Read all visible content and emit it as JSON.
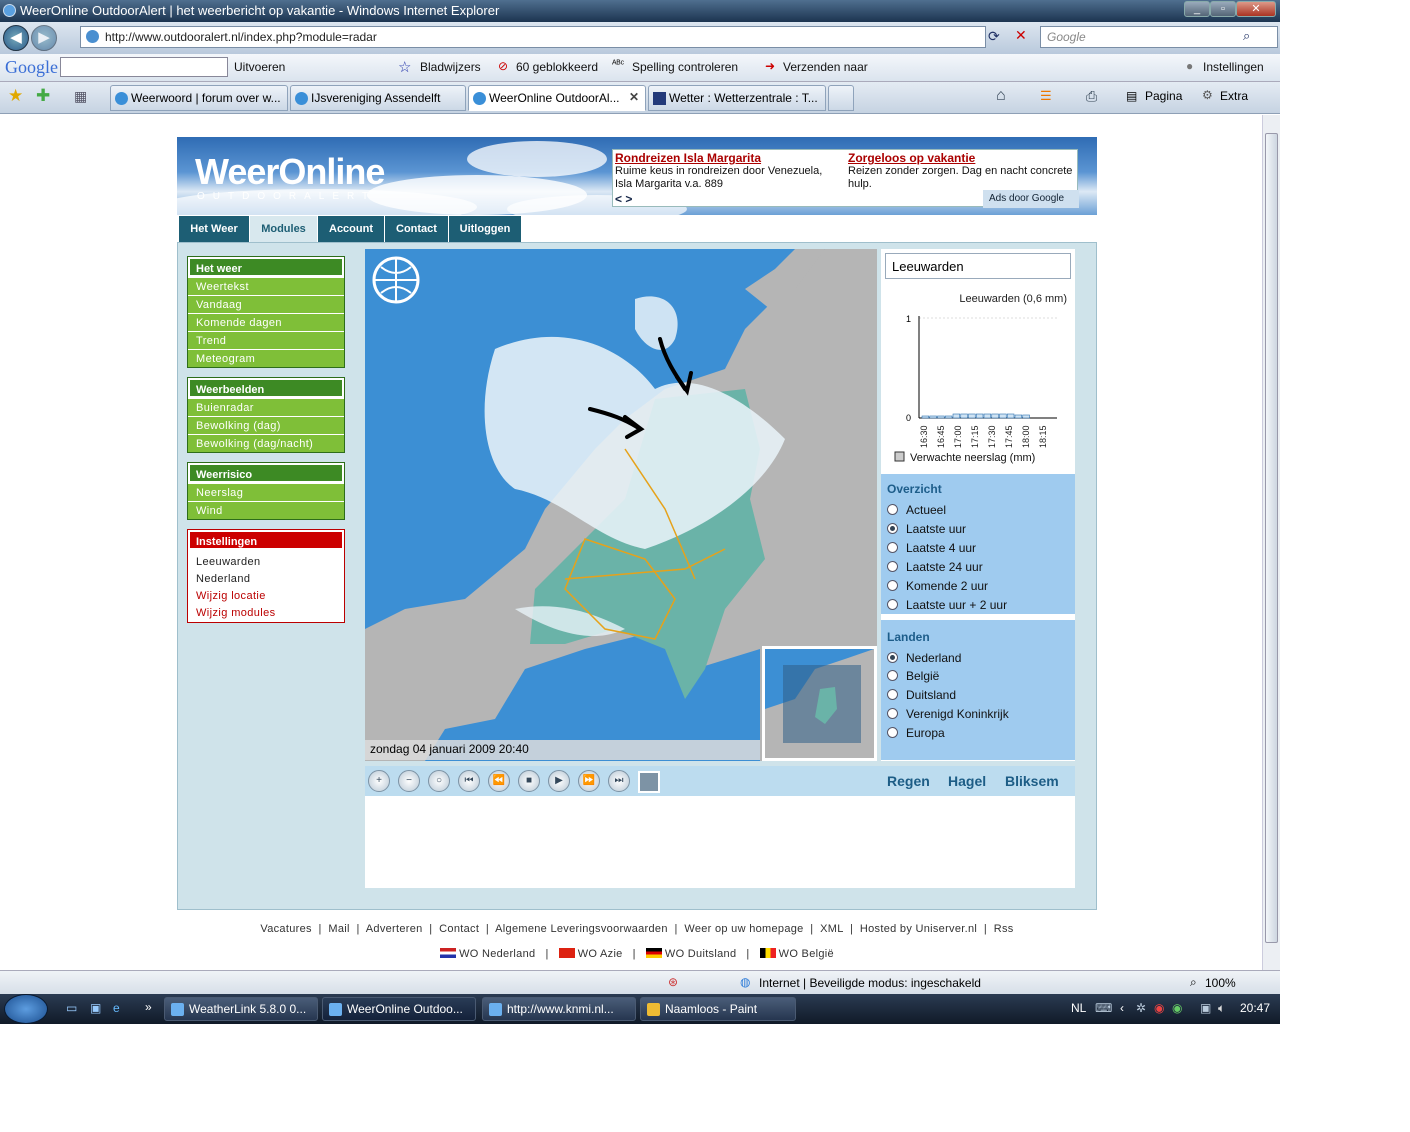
{
  "window": {
    "title": "WeerOnline OutdoorAlert | het weerbericht op vakantie - Windows Internet Explorer"
  },
  "address": {
    "url": "http://www.outdooralert.nl/index.php?module=radar",
    "search_placeholder": "Google"
  },
  "google_toolbar": {
    "logo": "Google",
    "go": "Uitvoeren",
    "bookmarks": "Bladwijzers",
    "blocked": "60 geblokkeerd",
    "spell": "Spelling controleren",
    "send": "Verzenden naar",
    "settings": "Instellingen"
  },
  "tabs": [
    {
      "label": "Weerwoord | forum over w..."
    },
    {
      "label": "IJsvereniging Assendelft"
    },
    {
      "label": "WeerOnline OutdoorAl..."
    },
    {
      "label": "Wetter : Wetterzentrale : T..."
    }
  ],
  "cmdbar": {
    "page": "Pagina",
    "extra": "Extra"
  },
  "site": {
    "logo": "WeerOnline",
    "logo_sub": "OUTDOORALERT",
    "ads": [
      {
        "title": "Rondreizen Isla Margarita",
        "text": "Ruime keus in rondreizen door Venezuela, Isla Margarita v.a. 889"
      },
      {
        "title": "Zorgeloos op vakantie",
        "text": "Reizen zonder zorgen. Dag en nacht concrete hulp."
      }
    ],
    "ads_nav": "< >",
    "ads_by": "Ads door Google",
    "nav": [
      "Het Weer",
      "Modules",
      "Account",
      "Contact",
      "Uitloggen"
    ],
    "sidebar": [
      {
        "title": "Het weer",
        "items": [
          "Weertekst",
          "Vandaag",
          "Komende dagen",
          "Trend",
          "Meteogram"
        ]
      },
      {
        "title": "Weerbeelden",
        "items": [
          "Buienradar",
          "Bewolking (dag)",
          "Bewolking (dag/nacht)"
        ]
      },
      {
        "title": "Weerrisico",
        "items": [
          "Neerslag",
          "Wind"
        ]
      },
      {
        "title": "Instellingen",
        "items": [
          "Leeuwarden",
          "Nederland",
          "Wijzig locatie",
          "Wijzig modules"
        ]
      }
    ],
    "map_date": "zondag 04 januari 2009 20:40",
    "controls_links": [
      "Regen",
      "Hagel",
      "Bliksem"
    ],
    "location_input": "Leeuwarden",
    "overview": {
      "title": "Overzicht",
      "options": [
        "Actueel",
        "Laatste uur",
        "Laatste 4 uur",
        "Laatste 24 uur",
        "Komende 2 uur",
        "Laatste uur + 2 uur"
      ],
      "selected": "Laatste uur"
    },
    "countries": {
      "title": "Landen",
      "options": [
        "Nederland",
        "België",
        "Duitsland",
        "Verenigd Koninkrijk",
        "Europa"
      ],
      "selected": "Nederland"
    },
    "footer_links": [
      "Vacatures",
      "Mail",
      "Adverteren",
      "Contact",
      "Algemene Leveringsvoorwaarden",
      "Weer op uw homepage",
      "XML",
      "Hosted by Uniserver.nl",
      "Rss"
    ],
    "footer_sites": [
      "WO Nederland",
      "WO Azie",
      "WO Duitsland",
      "WO België"
    ]
  },
  "chart_data": {
    "type": "bar",
    "title": "Leeuwarden (0,6 mm)",
    "categories": [
      "16:30",
      "16:45",
      "17:00",
      "17:15",
      "17:30",
      "17:45",
      "18:00",
      "18:15"
    ],
    "values": [
      0.02,
      0.02,
      0.04,
      0.04,
      0.04,
      0.04,
      0.03,
      0.0
    ],
    "ylim": [
      0,
      1
    ],
    "yticks": [
      "1",
      "0"
    ],
    "legend": "Verwachte neerslag (mm)"
  },
  "status": {
    "zone": "Internet | Beveiligde modus: ingeschakeld",
    "zoom": "100%"
  },
  "taskbar": {
    "items": [
      "WeatherLink 5.8.0  0...",
      "WeerOnline Outdoo...",
      "http://www.knmi.nl...",
      "Naamloos - Paint"
    ],
    "lang": "NL",
    "time": "20:47"
  }
}
